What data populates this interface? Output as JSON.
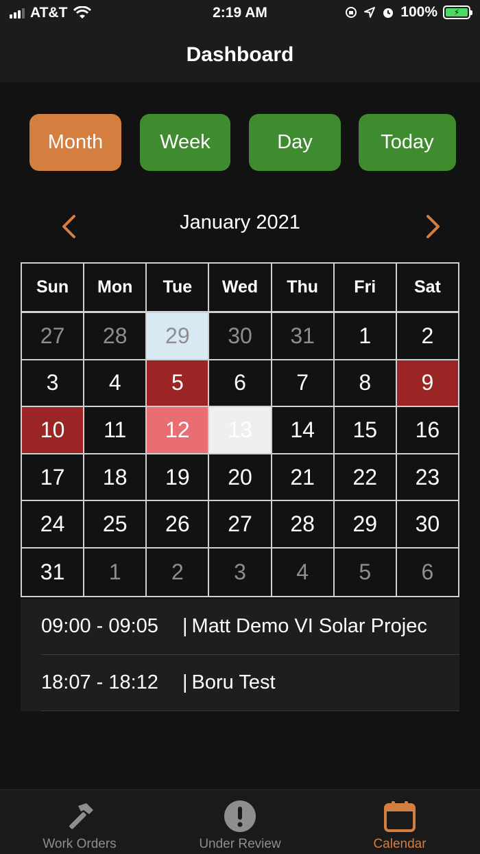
{
  "status_bar": {
    "carrier": "AT&T",
    "time": "2:19 AM",
    "battery": "100%"
  },
  "nav": {
    "title": "Dashboard"
  },
  "view_buttons": {
    "month": "Month",
    "week": "Week",
    "day": "Day",
    "today": "Today"
  },
  "calendar": {
    "month_title": "January 2021",
    "weekdays": [
      "Sun",
      "Mon",
      "Tue",
      "Wed",
      "Thu",
      "Fri",
      "Sat"
    ],
    "weeks": [
      [
        {
          "d": "27",
          "m": true
        },
        {
          "d": "28",
          "m": true
        },
        {
          "d": "29",
          "m": true,
          "bg": "#d9e9f4"
        },
        {
          "d": "30",
          "m": true
        },
        {
          "d": "31",
          "m": true
        },
        {
          "d": "1"
        },
        {
          "d": "2"
        }
      ],
      [
        {
          "d": "3"
        },
        {
          "d": "4"
        },
        {
          "d": "5",
          "bg": "#9b2424"
        },
        {
          "d": "6"
        },
        {
          "d": "7"
        },
        {
          "d": "8"
        },
        {
          "d": "9",
          "bg": "#9b2424"
        }
      ],
      [
        {
          "d": "10",
          "bg": "#9b2424"
        },
        {
          "d": "11"
        },
        {
          "d": "12",
          "bg": "#e86e74"
        },
        {
          "d": "13",
          "bg": "#efefef"
        },
        {
          "d": "14"
        },
        {
          "d": "15"
        },
        {
          "d": "16"
        }
      ],
      [
        {
          "d": "17"
        },
        {
          "d": "18"
        },
        {
          "d": "19"
        },
        {
          "d": "20"
        },
        {
          "d": "21"
        },
        {
          "d": "22"
        },
        {
          "d": "23"
        }
      ],
      [
        {
          "d": "24"
        },
        {
          "d": "25"
        },
        {
          "d": "26"
        },
        {
          "d": "27"
        },
        {
          "d": "28"
        },
        {
          "d": "29"
        },
        {
          "d": "30"
        }
      ],
      [
        {
          "d": "31"
        },
        {
          "d": "1",
          "m": true
        },
        {
          "d": "2",
          "m": true
        },
        {
          "d": "3",
          "m": true
        },
        {
          "d": "4",
          "m": true
        },
        {
          "d": "5",
          "m": true
        },
        {
          "d": "6",
          "m": true
        }
      ]
    ]
  },
  "events": [
    {
      "time": "09:00 - 09:05",
      "title": "Matt Demo VI Solar Projec"
    },
    {
      "time": "18:07 - 18:12",
      "title": "Boru Test"
    }
  ],
  "tabs": {
    "work_orders": "Work Orders",
    "under_review": "Under Review",
    "calendar": "Calendar"
  },
  "colors": {
    "accent": "#d47e3f",
    "button_green": "#3f8b2f",
    "event_dark_red": "#9b2424",
    "event_pink": "#e86e74",
    "selected_light_blue": "#d9e9f4"
  }
}
